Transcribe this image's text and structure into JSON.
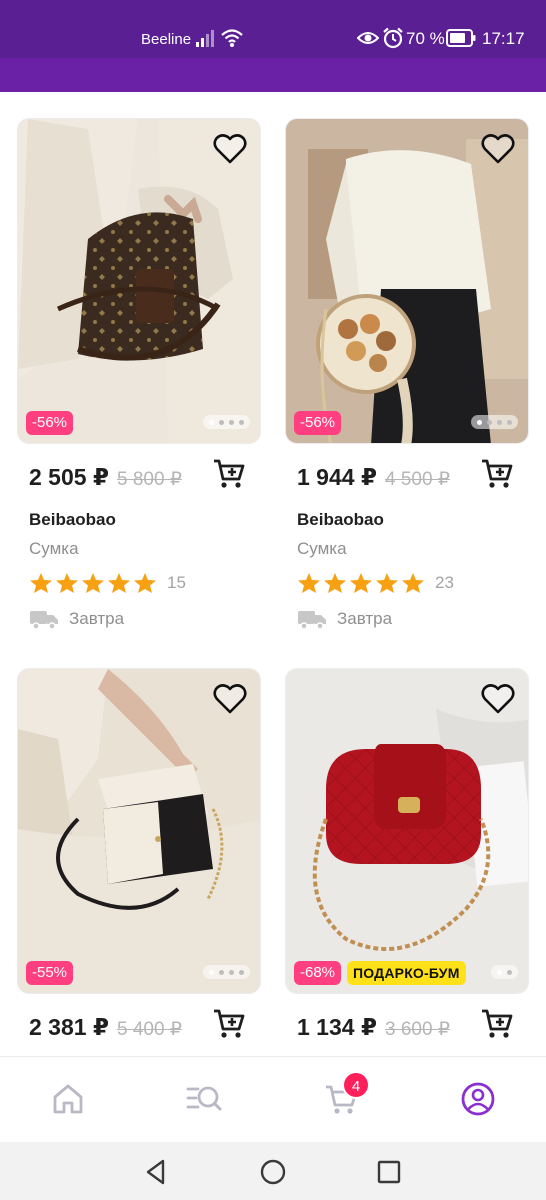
{
  "status_bar": {
    "carrier": "Beeline",
    "battery_percent": "70 %",
    "time": "17:17",
    "icons": [
      "signal-icon",
      "wifi-icon",
      "eye-icon",
      "alarm-icon",
      "battery-icon"
    ]
  },
  "colors": {
    "status_bg": "#5b1f94",
    "accent_purple": "#6a21a6",
    "discount_pink": "#ff3f7f",
    "promo_yellow": "#ffe11a",
    "star": "#f6a012",
    "badge": "#ff1f5a"
  },
  "products": [
    {
      "discount": "-56%",
      "price": "2 505 ₽",
      "old_price": "5 800 ₽",
      "brand": "Beibaobao",
      "kind": "Сумка",
      "rating": 5,
      "reviews": "15",
      "delivery": "Завтра",
      "image_slides": 4,
      "active_slide": 1
    },
    {
      "discount": "-56%",
      "price": "1 944 ₽",
      "old_price": "4 500 ₽",
      "brand": "Beibaobao",
      "kind": "Сумка",
      "rating": 5,
      "reviews": "23",
      "delivery": "Завтра",
      "image_slides": 4,
      "active_slide": 1
    },
    {
      "discount": "-55%",
      "price": "2 381 ₽",
      "old_price": "5 400 ₽",
      "image_slides": 4,
      "active_slide": 1
    },
    {
      "discount": "-68%",
      "promo": "ПОДАРКО-БУМ",
      "price": "1 134 ₽",
      "old_price": "3 600 ₽",
      "image_slides": 2,
      "active_slide": 1
    }
  ],
  "bottom_nav": {
    "items": [
      "home-icon",
      "catalog-search-icon",
      "cart-icon",
      "profile-icon"
    ],
    "cart_badge": "4",
    "active": "profile-icon"
  },
  "system_nav": [
    "back-icon",
    "home-circle-icon",
    "recents-icon"
  ]
}
